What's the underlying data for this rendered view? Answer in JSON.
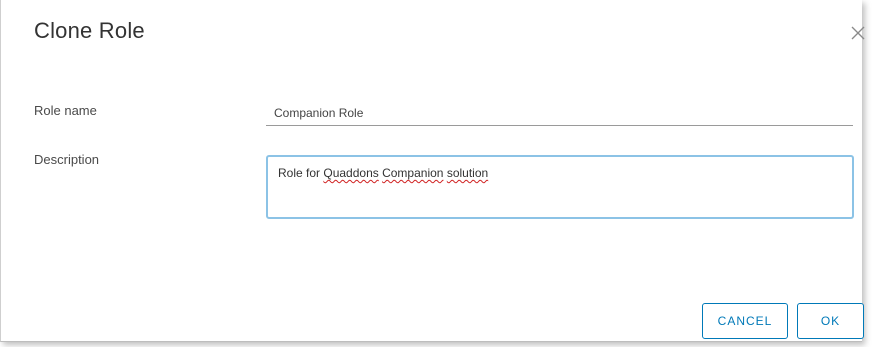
{
  "dialog": {
    "title": "Clone Role",
    "close_icon": "close-icon"
  },
  "form": {
    "role_name_label": "Role name",
    "role_name_value": "Companion Role",
    "description_label": "Description",
    "description_words": [
      "Role for ",
      "Quaddons",
      " ",
      "Companion",
      " ",
      "solution"
    ]
  },
  "buttons": {
    "cancel_label": "CANCEL",
    "ok_label": "OK"
  },
  "colors": {
    "accent": "#0079b8",
    "focus_border": "#8cc3e6",
    "spellcheck": "#d02020"
  }
}
